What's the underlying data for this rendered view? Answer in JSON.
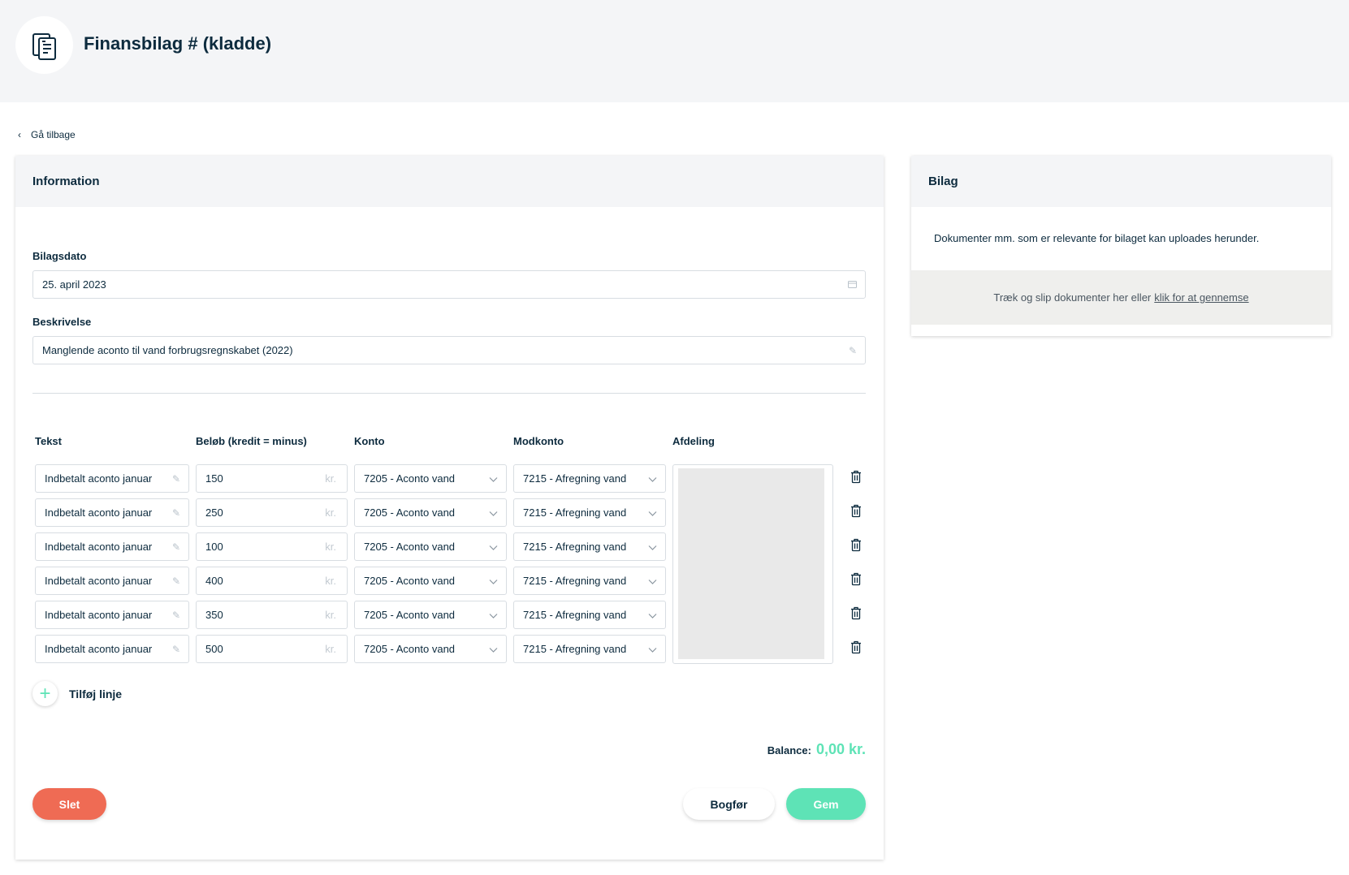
{
  "header": {
    "title": "Finansbilag # (kladde)",
    "logo_icon": "document-icon"
  },
  "nav": {
    "back_label": "Gå tilbage"
  },
  "info": {
    "title": "Information",
    "date_label": "Bilagsdato",
    "date_value": "25. april 2023",
    "desc_label": "Beskrivelse",
    "desc_value": "Manglende aconto til vand forbrugsregnskabet (2022)"
  },
  "table": {
    "headers": [
      "Tekst",
      "Beløb (kredit = minus)",
      "Konto",
      "Modkonto",
      "Afdeling"
    ],
    "unit": "kr.",
    "rows": [
      {
        "tekst": "Indbetalt aconto januar",
        "belob": "150",
        "konto": "7205 - Aconto vand",
        "modkonto": "7215 - Afregning vand"
      },
      {
        "tekst": "Indbetalt aconto januar",
        "belob": "250",
        "konto": "7205 - Aconto vand",
        "modkonto": "7215 - Afregning vand"
      },
      {
        "tekst": "Indbetalt aconto januar",
        "belob": "100",
        "konto": "7205 - Aconto vand",
        "modkonto": "7215 - Afregning vand"
      },
      {
        "tekst": "Indbetalt aconto januar",
        "belob": "400",
        "konto": "7205 - Aconto vand",
        "modkonto": "7215 - Afregning vand"
      },
      {
        "tekst": "Indbetalt aconto januar",
        "belob": "350",
        "konto": "7205 - Aconto vand",
        "modkonto": "7215 - Afregning vand"
      },
      {
        "tekst": "Indbetalt aconto januar",
        "belob": "500",
        "konto": "7205 - Aconto vand",
        "modkonto": "7215 - Afregning vand"
      }
    ]
  },
  "add_line_label": "Tilføj linje",
  "balance": {
    "label": "Balance:",
    "value": "0,00 kr."
  },
  "actions": {
    "delete_label": "Slet",
    "post_label": "Bogfør",
    "save_label": "Gem"
  },
  "bilag": {
    "title": "Bilag",
    "description": "Dokumenter mm. som er relevante for bilaget kan uploades herunder.",
    "drop_text": "Træk og slip dokumenter her eller",
    "browse_link": "klik for at gennemse"
  },
  "colors": {
    "accent": "#5ee3b6",
    "danger": "#ef6b54",
    "text": "#0d2b3e",
    "header_bg": "#f4f5f7"
  }
}
